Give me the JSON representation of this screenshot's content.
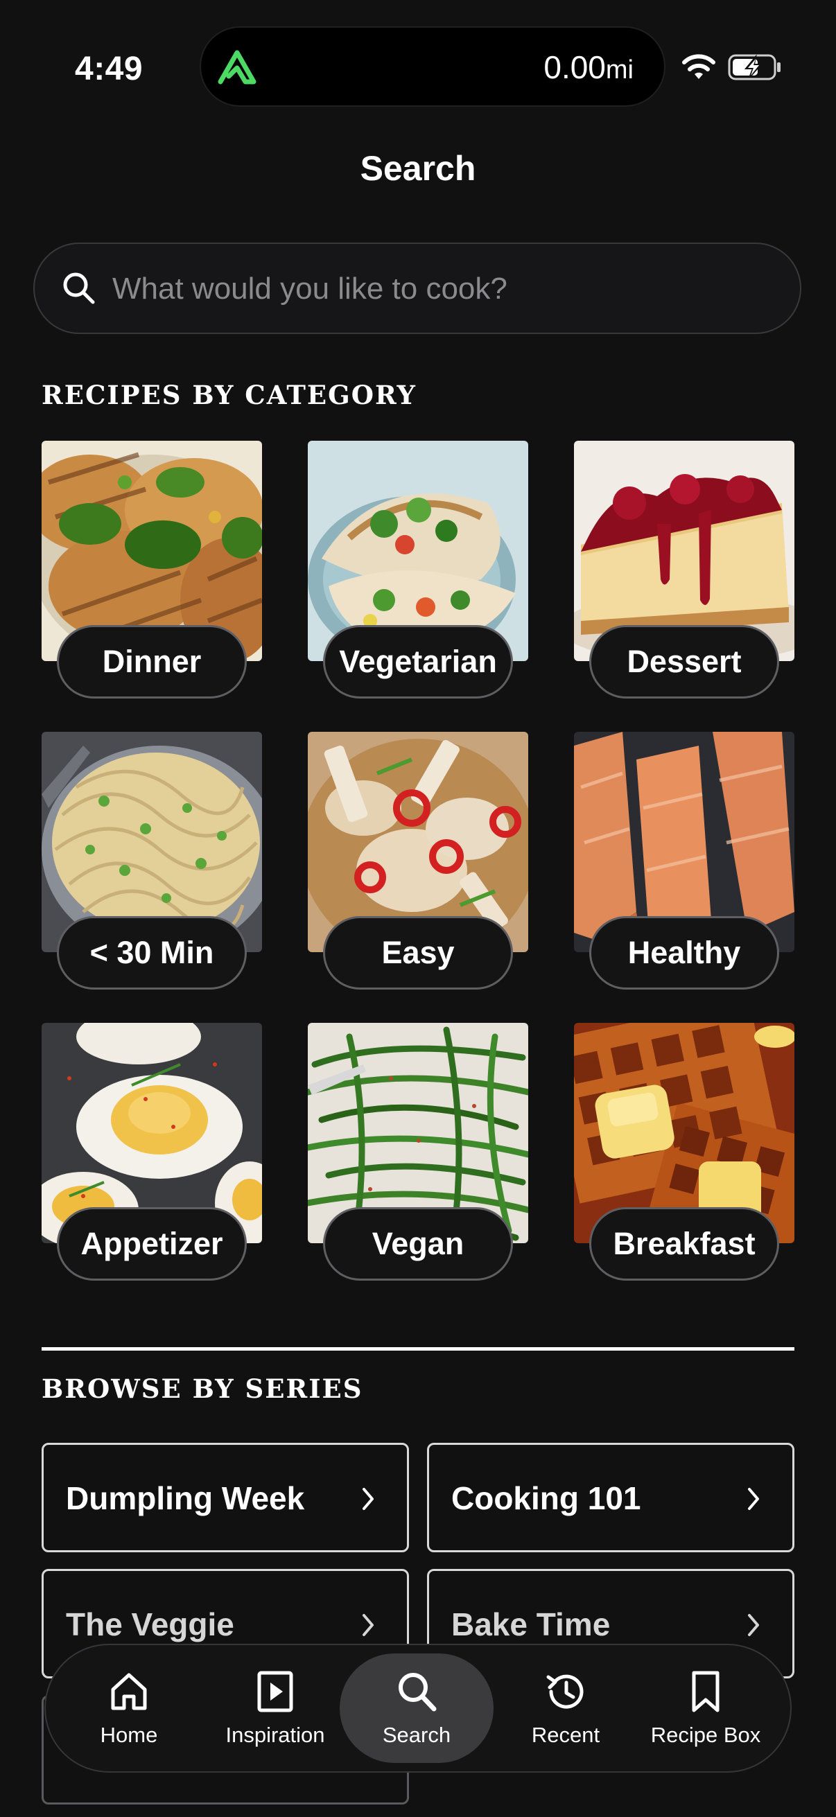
{
  "status_bar": {
    "time": "4:49",
    "distance_value": "0.00",
    "distance_unit": "mi",
    "icons": [
      "app-logo-icon",
      "wifi-icon",
      "battery-charging-icon"
    ]
  },
  "header": {
    "title": "Search"
  },
  "search": {
    "placeholder": "What would you like to cook?",
    "value": ""
  },
  "categories": {
    "heading": "RECIPES BY CATEGORY",
    "items": [
      {
        "label": "Dinner"
      },
      {
        "label": "Vegetarian"
      },
      {
        "label": "Dessert"
      },
      {
        "label": "< 30 Min"
      },
      {
        "label": "Easy"
      },
      {
        "label": "Healthy"
      },
      {
        "label": "Appetizer"
      },
      {
        "label": "Vegan"
      },
      {
        "label": "Breakfast"
      }
    ]
  },
  "series": {
    "heading": "BROWSE BY SERIES",
    "items": [
      {
        "label": "Dumpling Week"
      },
      {
        "label": "Cooking 101"
      },
      {
        "label": "The Veggie"
      },
      {
        "label": "Bake Time"
      }
    ]
  },
  "bottom_nav": {
    "active": "Search",
    "items": [
      {
        "label": "Home",
        "icon": "home-icon"
      },
      {
        "label": "Inspiration",
        "icon": "play-icon"
      },
      {
        "label": "Search",
        "icon": "search-icon"
      },
      {
        "label": "Recent",
        "icon": "history-icon"
      },
      {
        "label": "Recipe Box",
        "icon": "bookmark-icon"
      }
    ]
  },
  "colors": {
    "background": "#111112",
    "app_logo_green": "#4cd964",
    "nav_active_bg": "#3b3b3d"
  }
}
